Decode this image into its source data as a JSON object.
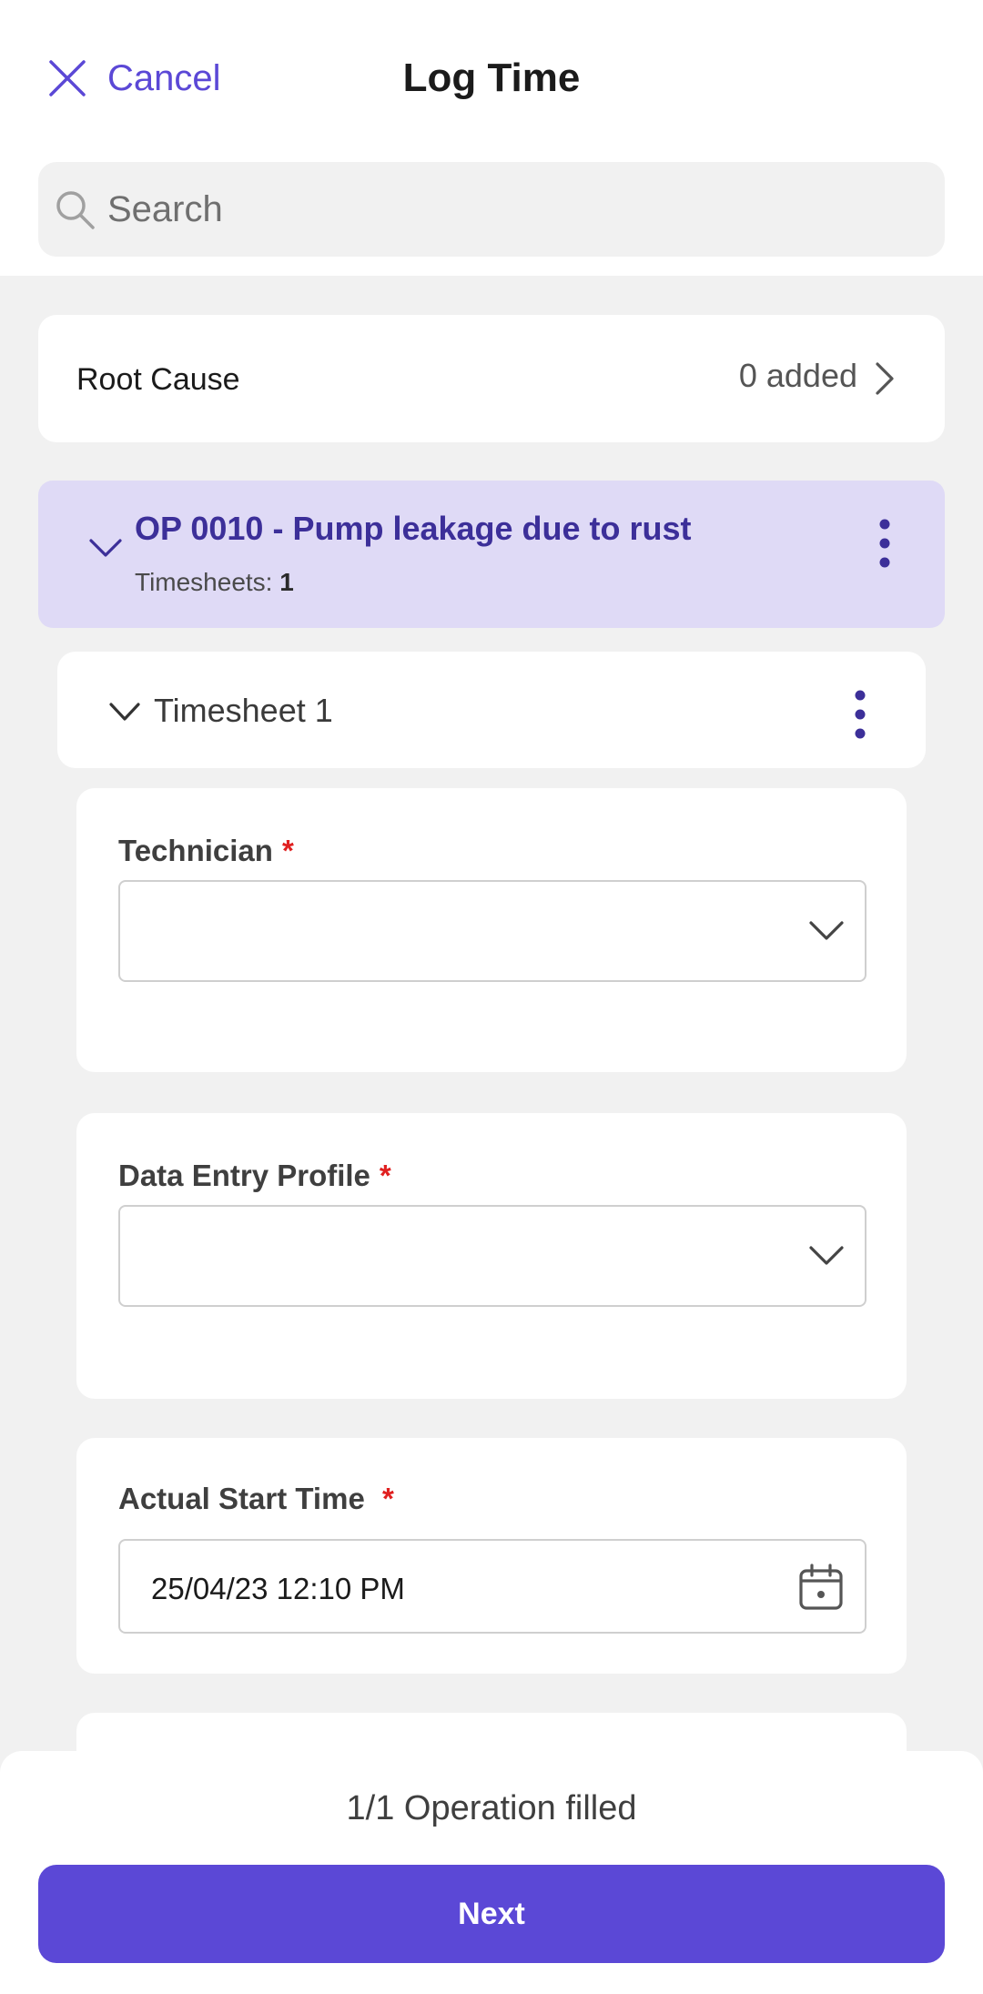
{
  "header": {
    "cancel_label": "Cancel",
    "title": "Log Time",
    "search_placeholder": "Search"
  },
  "root_cause": {
    "label": "Root Cause",
    "value": "0 added"
  },
  "operation": {
    "name": "OP 0010 - Pump leakage due to rust",
    "timesheets_label": "Timesheets:",
    "timesheets_count": "1"
  },
  "timesheet": {
    "name": "Timesheet 1"
  },
  "fields": {
    "technician": {
      "label": "Technician",
      "required": "*",
      "value": ""
    },
    "data_entry_profile": {
      "label": "Data Entry Profile",
      "required": "*",
      "value": ""
    },
    "actual_start_time": {
      "label": "Actual Start Time",
      "required": "*",
      "value": "25/04/23 12:10 PM"
    }
  },
  "footer": {
    "status": "1/1 Operation filled",
    "next_label": "Next"
  },
  "colors": {
    "accent": "#5b48d6",
    "operation_bg": "#dfdaf6",
    "operation_text": "#3c2f99",
    "required": "#e02020"
  }
}
